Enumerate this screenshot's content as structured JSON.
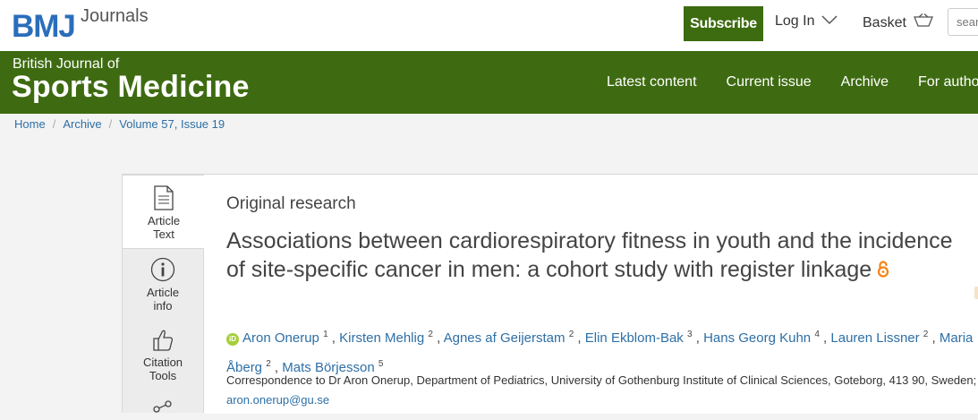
{
  "header": {
    "logo_brand": "BMJ",
    "logo_sub": "Journals",
    "subscribe_label": "Subscribe",
    "login_label": "Log In",
    "basket_label": "Basket",
    "search_placeholder": "search"
  },
  "journal": {
    "line1": "British Journal of",
    "line2": "Sports Medicine",
    "nav": [
      "Latest content",
      "Current issue",
      "Archive",
      "For authors"
    ]
  },
  "breadcrumb": [
    "Home",
    "Archive",
    "Volume 57, Issue 19"
  ],
  "tools": [
    {
      "label": "Article Text",
      "icon": "document-icon"
    },
    {
      "label": "Article info",
      "icon": "info-icon"
    },
    {
      "label": "Citation Tools",
      "icon": "thumbs-up-icon"
    }
  ],
  "article": {
    "type": "Original research",
    "title": "Associations between cardiorespiratory fitness in youth and the incidence of site-specific cancer in men: a cohort study with register linkage",
    "open_access_icon": "open-access-lock-icon",
    "authors": [
      {
        "name": "Aron Onerup",
        "sup": "1",
        "orcid": "iD"
      },
      {
        "name": "Kirsten Mehlig",
        "sup": "2"
      },
      {
        "name": "Agnes af Geijerstam",
        "sup": "2"
      },
      {
        "name": "Elin Ekblom-Bak",
        "sup": "3"
      },
      {
        "name": "Hans Georg Kuhn",
        "sup": "4"
      },
      {
        "name": "Lauren Lissner",
        "sup": "2"
      },
      {
        "name": "Maria Åberg",
        "sup": "2"
      },
      {
        "name": "Mats Börjesson",
        "sup": "5"
      }
    ],
    "correspondence": "Correspondence to Dr Aron Onerup, Department of Pediatrics, University of Gothenburg Institute of Clinical Sciences, Goteborg, 413 90, Sweden;",
    "email": "aron.onerup@gu.se"
  },
  "colors": {
    "brand_blue": "#2a6ebb",
    "journal_green": "#3e6b11",
    "link_blue": "#2d6fa6",
    "open_access_orange": "#f68212",
    "orcid_green": "#a6ce39"
  }
}
